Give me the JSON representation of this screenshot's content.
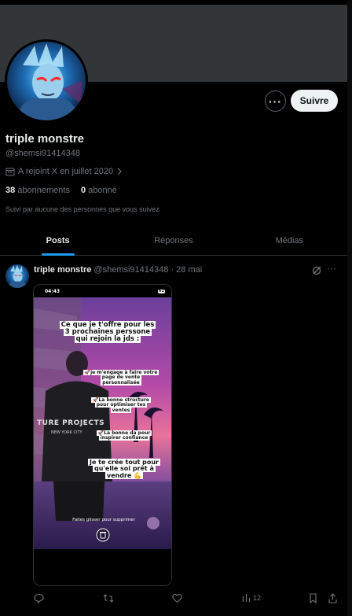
{
  "profile": {
    "name": "triple monstre",
    "handle": "@shemsi91414348",
    "joined": "A rejoint X en juillet 2020",
    "following_count": "38",
    "following_label": "abonnements",
    "followers_count": "0",
    "followers_label": "abonné",
    "followed_by": "Suivi par aucune des personnes que vous suivez",
    "follow_label": "Suivre"
  },
  "tabs": [
    {
      "label": "Posts",
      "active": true
    },
    {
      "label": "Réponses",
      "active": false
    },
    {
      "label": "Médias",
      "active": false
    }
  ],
  "post": {
    "author": "triple monstre",
    "handle": "@shemsi91414348",
    "separator": "·",
    "date": "28 mai",
    "media": {
      "status_time": "04:43",
      "battery": "61",
      "title": "Ce que je t'offre pour les 3 prochaines perssone qui rejoin la jds :",
      "bullet1": "🚀je m'engage à faire votre page de vente personnalisée",
      "bullet2": "🚀La bonne structure pour optimiser tes ventes",
      "bullet3": "🚀La bonne da pour inspirer confiance",
      "closing": "Je te crée tout pour qu'elle soi prêt à vendre 💪",
      "shirt_text": "TURE PROJECTS",
      "shirt_sub": "NEW YORK CITY",
      "swipe_hint": "Faites glisser pour supprimer"
    },
    "views": "12"
  },
  "colors": {
    "accent": "#1d9bf0",
    "banner": "#333639",
    "muted": "#71767b"
  }
}
